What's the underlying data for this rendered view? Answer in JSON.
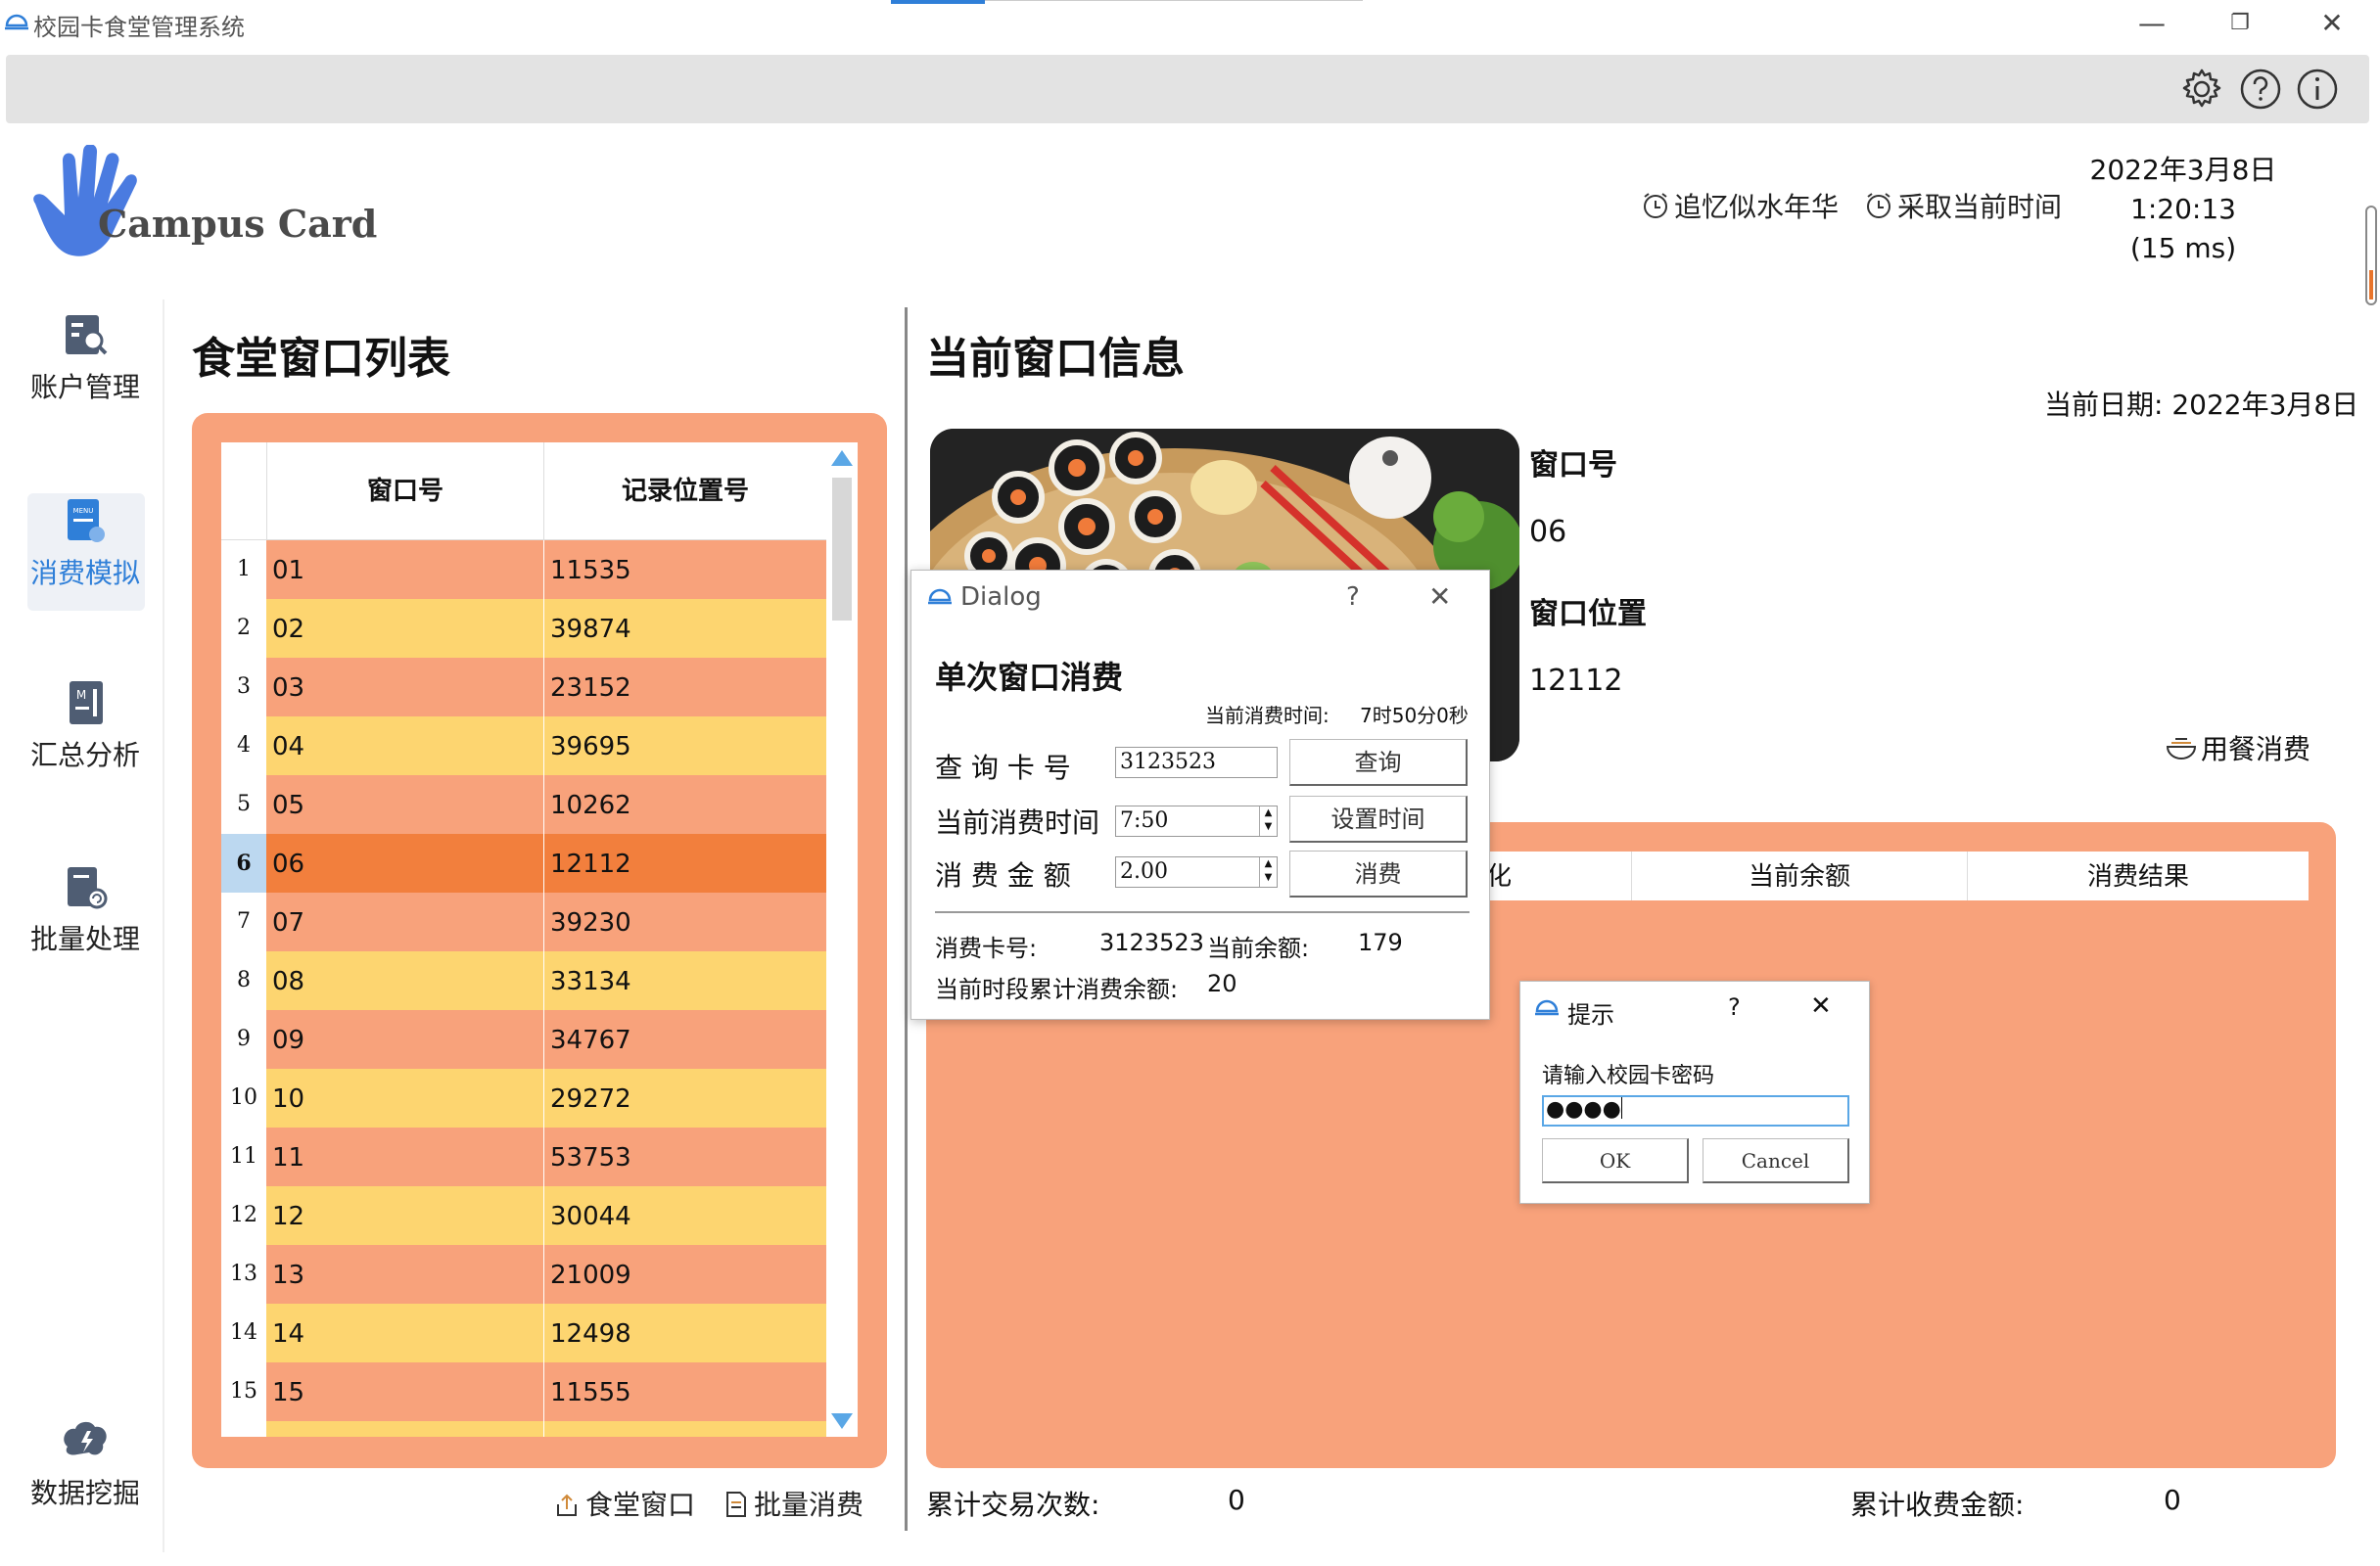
{
  "window": {
    "title": "校园卡食堂管理系统",
    "min_label": "—",
    "max_label": "❐",
    "close_label": "✕"
  },
  "toolbar": {
    "icons": [
      "settings-icon",
      "help-icon",
      "info-icon"
    ]
  },
  "header": {
    "logo_text": "Campus Card",
    "link_memory": "追忆似水年华",
    "link_time": "采取当前时间",
    "date": "2022年3月8日",
    "time": "1:20:13",
    "ms": "(15 ms)"
  },
  "sidebar": {
    "items": [
      {
        "label": "账户管理"
      },
      {
        "label": "消费模拟"
      },
      {
        "label": "汇总分析"
      },
      {
        "label": "批量处理"
      },
      {
        "label": "数据挖掘"
      }
    ],
    "active_index": 1
  },
  "left": {
    "title": "食堂窗口列表",
    "col_window": "窗口号",
    "col_record": "记录位置号",
    "rows": [
      {
        "n": "1",
        "w": "01",
        "r": "11535"
      },
      {
        "n": "2",
        "w": "02",
        "r": "39874"
      },
      {
        "n": "3",
        "w": "03",
        "r": "23152"
      },
      {
        "n": "4",
        "w": "04",
        "r": "39695"
      },
      {
        "n": "5",
        "w": "05",
        "r": "10262"
      },
      {
        "n": "6",
        "w": "06",
        "r": "12112"
      },
      {
        "n": "7",
        "w": "07",
        "r": "39230"
      },
      {
        "n": "8",
        "w": "08",
        "r": "33134"
      },
      {
        "n": "9",
        "w": "09",
        "r": "34767"
      },
      {
        "n": "10",
        "w": "10",
        "r": "29272"
      },
      {
        "n": "11",
        "w": "11",
        "r": "53753"
      },
      {
        "n": "12",
        "w": "12",
        "r": "30044"
      },
      {
        "n": "13",
        "w": "13",
        "r": "21009"
      },
      {
        "n": "14",
        "w": "14",
        "r": "12498"
      },
      {
        "n": "15",
        "w": "15",
        "r": "11555"
      }
    ],
    "selected_index": 5,
    "btn_windows": "食堂窗口",
    "btn_batch": "批量消费"
  },
  "right": {
    "title": "当前窗口信息",
    "date_label": "当前日期: 2022年3月8日",
    "window_no_label": "窗口号",
    "window_no": "06",
    "window_pos_label": "窗口位置",
    "window_pos": "12112",
    "meal_btn": "用餐消费",
    "col_partial": "化",
    "col_balance": "当前余额",
    "col_result": "消费结果",
    "total_tx_label": "累计交易次数:",
    "total_tx": "0",
    "total_amount_label": "累计收费金额:",
    "total_amount": "0"
  },
  "dialog": {
    "title": "Dialog",
    "help": "?",
    "close": "✕",
    "heading": "单次窗口消费",
    "cur_time_label": "当前消费时间:",
    "cur_time": "7时50分0秒",
    "query_label": "查 询 卡 号",
    "query_value": "3123523",
    "query_btn": "查询",
    "time_label": "当前消费时间",
    "time_value": "7:50",
    "time_btn": "设置时间",
    "amount_label": "消 费 金 额",
    "amount_value": "2.00",
    "amount_btn": "消费",
    "card_label": "消费卡号:",
    "card_value": "3123523",
    "balance_label": "当前余额:",
    "balance_value": "179",
    "period_label": "当前时段累计消费余额:",
    "period_value": "20"
  },
  "prompt": {
    "title": "提示",
    "help": "?",
    "close": "✕",
    "message": "请输入校园卡密码",
    "password_mask": "●●●●",
    "ok": "OK",
    "cancel": "Cancel"
  },
  "colors": {
    "accent_orange": "#f8a27b",
    "row_orange": "#f8a27b",
    "row_yellow": "#fdd570",
    "row_selected": "#f27f3d",
    "logo_blue": "#4a7be0",
    "sidebar_active": "#2f7fd8"
  }
}
